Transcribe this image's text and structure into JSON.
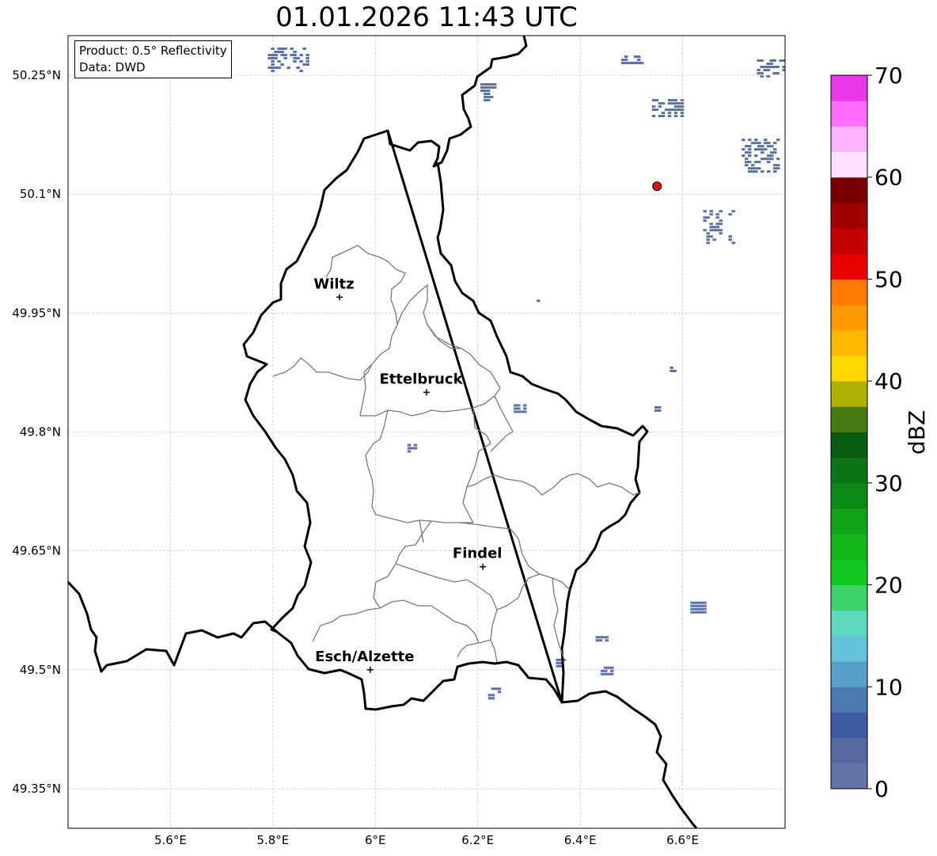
{
  "title": "01.01.2026 11:43 UTC",
  "info": {
    "product": "Product: 0.5° Reflectivity",
    "source": "Data: DWD"
  },
  "map": {
    "lon_range": [
      5.4,
      6.8
    ],
    "lat_range": [
      49.3,
      50.3
    ],
    "x_ticks": [
      "5.6°E",
      "5.8°E",
      "6°E",
      "6.2°E",
      "6.4°E",
      "6.6°E"
    ],
    "y_ticks": [
      "50.25°N",
      "50.1°N",
      "49.95°N",
      "49.8°N",
      "49.65°N",
      "49.5°N",
      "49.35°N"
    ],
    "gridlines": true
  },
  "cities": [
    {
      "name": "Wiltz",
      "lon": 5.93,
      "lat": 49.97
    },
    {
      "name": "Ettelbruck",
      "lon": 6.1,
      "lat": 49.85
    },
    {
      "name": "Findel",
      "lon": 6.21,
      "lat": 49.63
    },
    {
      "name": "Esch/Alzette",
      "lon": 5.99,
      "lat": 49.5
    }
  ],
  "radar_site": {
    "lon": 6.55,
    "lat": 50.11,
    "color": "#e81010"
  },
  "colorbar": {
    "label": "dBZ",
    "ticks": [
      "0",
      "10",
      "20",
      "30",
      "40",
      "50",
      "60",
      "70"
    ],
    "min": 0,
    "max": 70,
    "colors": [
      "#6574a6",
      "#55689f",
      "#3f5a9e",
      "#4a7ab0",
      "#59a0c8",
      "#65c4dc",
      "#5fd8c0",
      "#3cd36c",
      "#10c81e",
      "#12b81a",
      "#10a318",
      "#0c8a16",
      "#0a7514",
      "#075c10",
      "#457a10",
      "#b0b000",
      "#ffd800",
      "#ffb800",
      "#ff9a00",
      "#ff7a00",
      "#e60000",
      "#c40000",
      "#a00000",
      "#780000",
      "#ffe0ff",
      "#ffb4ff",
      "#ff6eff",
      "#e838e8"
    ]
  },
  "echo_color": "#5a72a8",
  "echoes": [
    {
      "lon": 6.57,
      "lat": 50.21,
      "w": 0.06,
      "h": 0.02,
      "density": 0.6
    },
    {
      "lon": 6.75,
      "lat": 50.15,
      "w": 0.07,
      "h": 0.04,
      "density": 0.5
    },
    {
      "lon": 6.67,
      "lat": 50.06,
      "w": 0.06,
      "h": 0.04,
      "density": 0.3
    },
    {
      "lon": 6.5,
      "lat": 50.27,
      "w": 0.04,
      "h": 0.01,
      "density": 0.6
    },
    {
      "lon": 6.77,
      "lat": 50.26,
      "w": 0.05,
      "h": 0.02,
      "density": 0.6
    },
    {
      "lon": 6.22,
      "lat": 50.23,
      "w": 0.03,
      "h": 0.02,
      "density": 0.7
    },
    {
      "lon": 5.83,
      "lat": 50.27,
      "w": 0.08,
      "h": 0.03,
      "density": 0.45
    },
    {
      "lon": 5.63,
      "lat": 50.28,
      "w": 0.05,
      "h": 0.02,
      "density": 0.4
    },
    {
      "lon": 6.28,
      "lat": 49.83,
      "w": 0.02,
      "h": 0.01,
      "density": 0.8
    },
    {
      "lon": 6.07,
      "lat": 49.78,
      "w": 0.015,
      "h": 0.01,
      "density": 0.8
    },
    {
      "lon": 6.63,
      "lat": 49.58,
      "w": 0.03,
      "h": 0.012,
      "density": 0.9
    },
    {
      "lon": 6.44,
      "lat": 49.54,
      "w": 0.02,
      "h": 0.005,
      "density": 0.9
    },
    {
      "lon": 6.45,
      "lat": 49.5,
      "w": 0.02,
      "h": 0.008,
      "density": 0.8
    },
    {
      "lon": 6.36,
      "lat": 49.51,
      "w": 0.015,
      "h": 0.008,
      "density": 0.8
    },
    {
      "lon": 6.23,
      "lat": 49.47,
      "w": 0.02,
      "h": 0.015,
      "density": 0.6
    },
    {
      "lon": 6.55,
      "lat": 49.83,
      "w": 0.01,
      "h": 0.005,
      "density": 0.8
    },
    {
      "lon": 6.32,
      "lat": 49.97,
      "w": 0.01,
      "h": 0.01,
      "density": 0.6
    },
    {
      "lon": 6.58,
      "lat": 49.88,
      "w": 0.01,
      "h": 0.005,
      "density": 0.8
    }
  ]
}
